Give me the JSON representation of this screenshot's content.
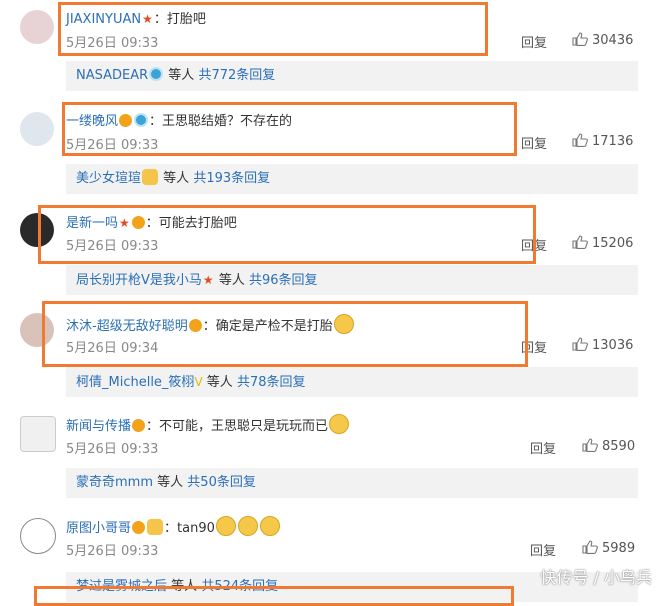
{
  "comments": [
    {
      "user": "JIAXINYUAN",
      "text": "打胎吧",
      "time": "5月26日 09:33",
      "reply": "回复",
      "likes": "30436",
      "sub": {
        "name": "NASADEAR",
        "etc": "等人",
        "count": "共772条回复"
      }
    },
    {
      "user": "一缕晚风",
      "text": "王思聪结婚？不存在的",
      "time": "5月26日 09:33",
      "reply": "回复",
      "likes": "17136",
      "sub": {
        "name": "美少女瑄瑄",
        "etc": "等人",
        "count": "共193条回复"
      }
    },
    {
      "user": "是新一吗",
      "text": "可能去打胎吧",
      "time": "5月26日 09:33",
      "reply": "回复",
      "likes": "15206",
      "sub": {
        "name": "局长别开枪V是我小马",
        "etc": "等人",
        "count": "共96条回复"
      }
    },
    {
      "user": "沐沐-超级无敌好聪明",
      "text": "确定是产检不是打胎",
      "time": "5月26日 09:34",
      "reply": "回复",
      "likes": "13036",
      "sub": {
        "name": "柯倩_Michelle_筱栩",
        "etc": "等人",
        "count": "共78条回复"
      }
    },
    {
      "user": "新闻与传播",
      "text": "不可能，王思聪只是玩玩而已",
      "time": "5月26日 09:33",
      "reply": "回复",
      "likes": "8590",
      "sub": {
        "name": "蒙奇奇mmm",
        "etc": "等人",
        "count": "共50条回复"
      }
    },
    {
      "user": "原图小哥哥",
      "text": "tan90",
      "time": "5月26日 09:33",
      "reply": "回复",
      "likes": "5989",
      "sub": {
        "name": "梦过是雾城之后",
        "etc": "等人",
        "count": "共524条回复"
      }
    }
  ],
  "watermark": "快传号 / 小鸟兵",
  "colors": {
    "link": "#2b6fb6",
    "frame": "#f07a32",
    "time": "#888888"
  }
}
